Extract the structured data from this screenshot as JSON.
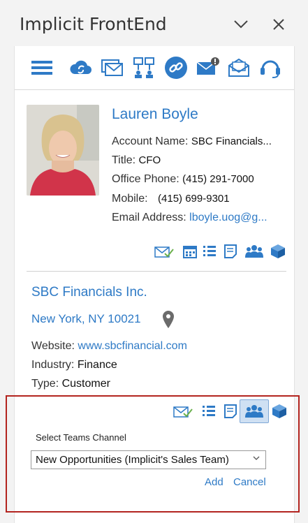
{
  "window": {
    "title": "Implicit FrontEnd"
  },
  "toolbar": {
    "icons": [
      "menu-icon",
      "cloud-sync-icon",
      "email-stack-icon",
      "org-chart-icon",
      "link-icon",
      "email-alert-icon",
      "envelope-open-icon",
      "headset-icon"
    ]
  },
  "contact": {
    "name": "Lauren Boyle",
    "account_label": "Account Name:",
    "account_value": "SBC Financials...",
    "title_label": "Title:",
    "title_value": "CFO",
    "office_label": "Office Phone:",
    "office_value": "(415) 291-7000",
    "mobile_label": "Mobile:",
    "mobile_value": "(415) 699-9301",
    "email_label": "Email Address:",
    "email_value": "lboyle.uog@g..."
  },
  "company": {
    "name": "SBC Financials Inc.",
    "address": "New York, NY 10021",
    "website_label": "Website:",
    "website_value": "www.sbcfinancial.com",
    "industry_label": "Industry:",
    "industry_value": "Finance",
    "type_label": "Type:",
    "type_value": "Customer"
  },
  "teams": {
    "select_label": "Select Teams Channel",
    "selected_channel": "New Opportunities (Implicit's Sales Team)",
    "add_label": "Add",
    "cancel_label": "Cancel"
  },
  "colors": {
    "accent": "#2e7ac6",
    "highlight_border": "#b3241f"
  }
}
